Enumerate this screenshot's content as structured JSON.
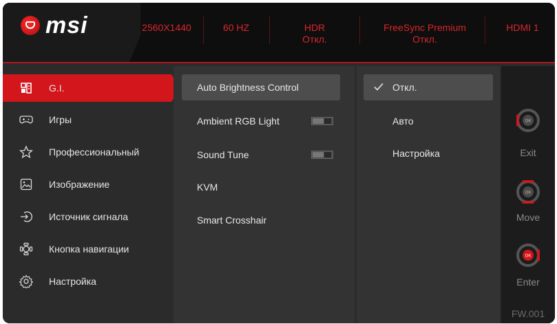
{
  "brand": {
    "name": "msi"
  },
  "specs": [
    {
      "line1": "2560X1440",
      "line2": ""
    },
    {
      "line1": "60 HZ",
      "line2": ""
    },
    {
      "line1": "HDR",
      "line2": "Откл."
    },
    {
      "line1": "FreeSync Premium",
      "line2": "Откл."
    },
    {
      "line1": "HDMI 1",
      "line2": ""
    }
  ],
  "menu": {
    "items": [
      {
        "label": "G.I.",
        "icon": "gaming-intelligence-icon",
        "active": true
      },
      {
        "label": "Игры",
        "icon": "gamepad-icon"
      },
      {
        "label": "Профессиональный",
        "icon": "star-icon"
      },
      {
        "label": "Изображение",
        "icon": "image-icon"
      },
      {
        "label": "Источник сигнала",
        "icon": "input-source-icon"
      },
      {
        "label": "Кнопка навигации",
        "icon": "navi-key-icon"
      },
      {
        "label": "Настройка",
        "icon": "gear-icon"
      }
    ]
  },
  "submenu": {
    "items": [
      {
        "label": "Auto Brightness Control",
        "selected": true
      },
      {
        "label": "Ambient RGB Light",
        "toggle": "off"
      },
      {
        "label": "Sound Tune",
        "toggle": "off"
      },
      {
        "label": "KVM"
      },
      {
        "label": "Smart Crosshair"
      }
    ]
  },
  "options": {
    "items": [
      {
        "label": "Откл.",
        "checked": true
      },
      {
        "label": "Авто"
      },
      {
        "label": "Настройка"
      }
    ]
  },
  "guide": {
    "exit": "Exit",
    "move": "Move",
    "enter": "Enter",
    "fw": "FW.001"
  },
  "colors": {
    "accent": "#d2161c",
    "spec_text": "#d8262b",
    "background": "#2b2b2b"
  }
}
